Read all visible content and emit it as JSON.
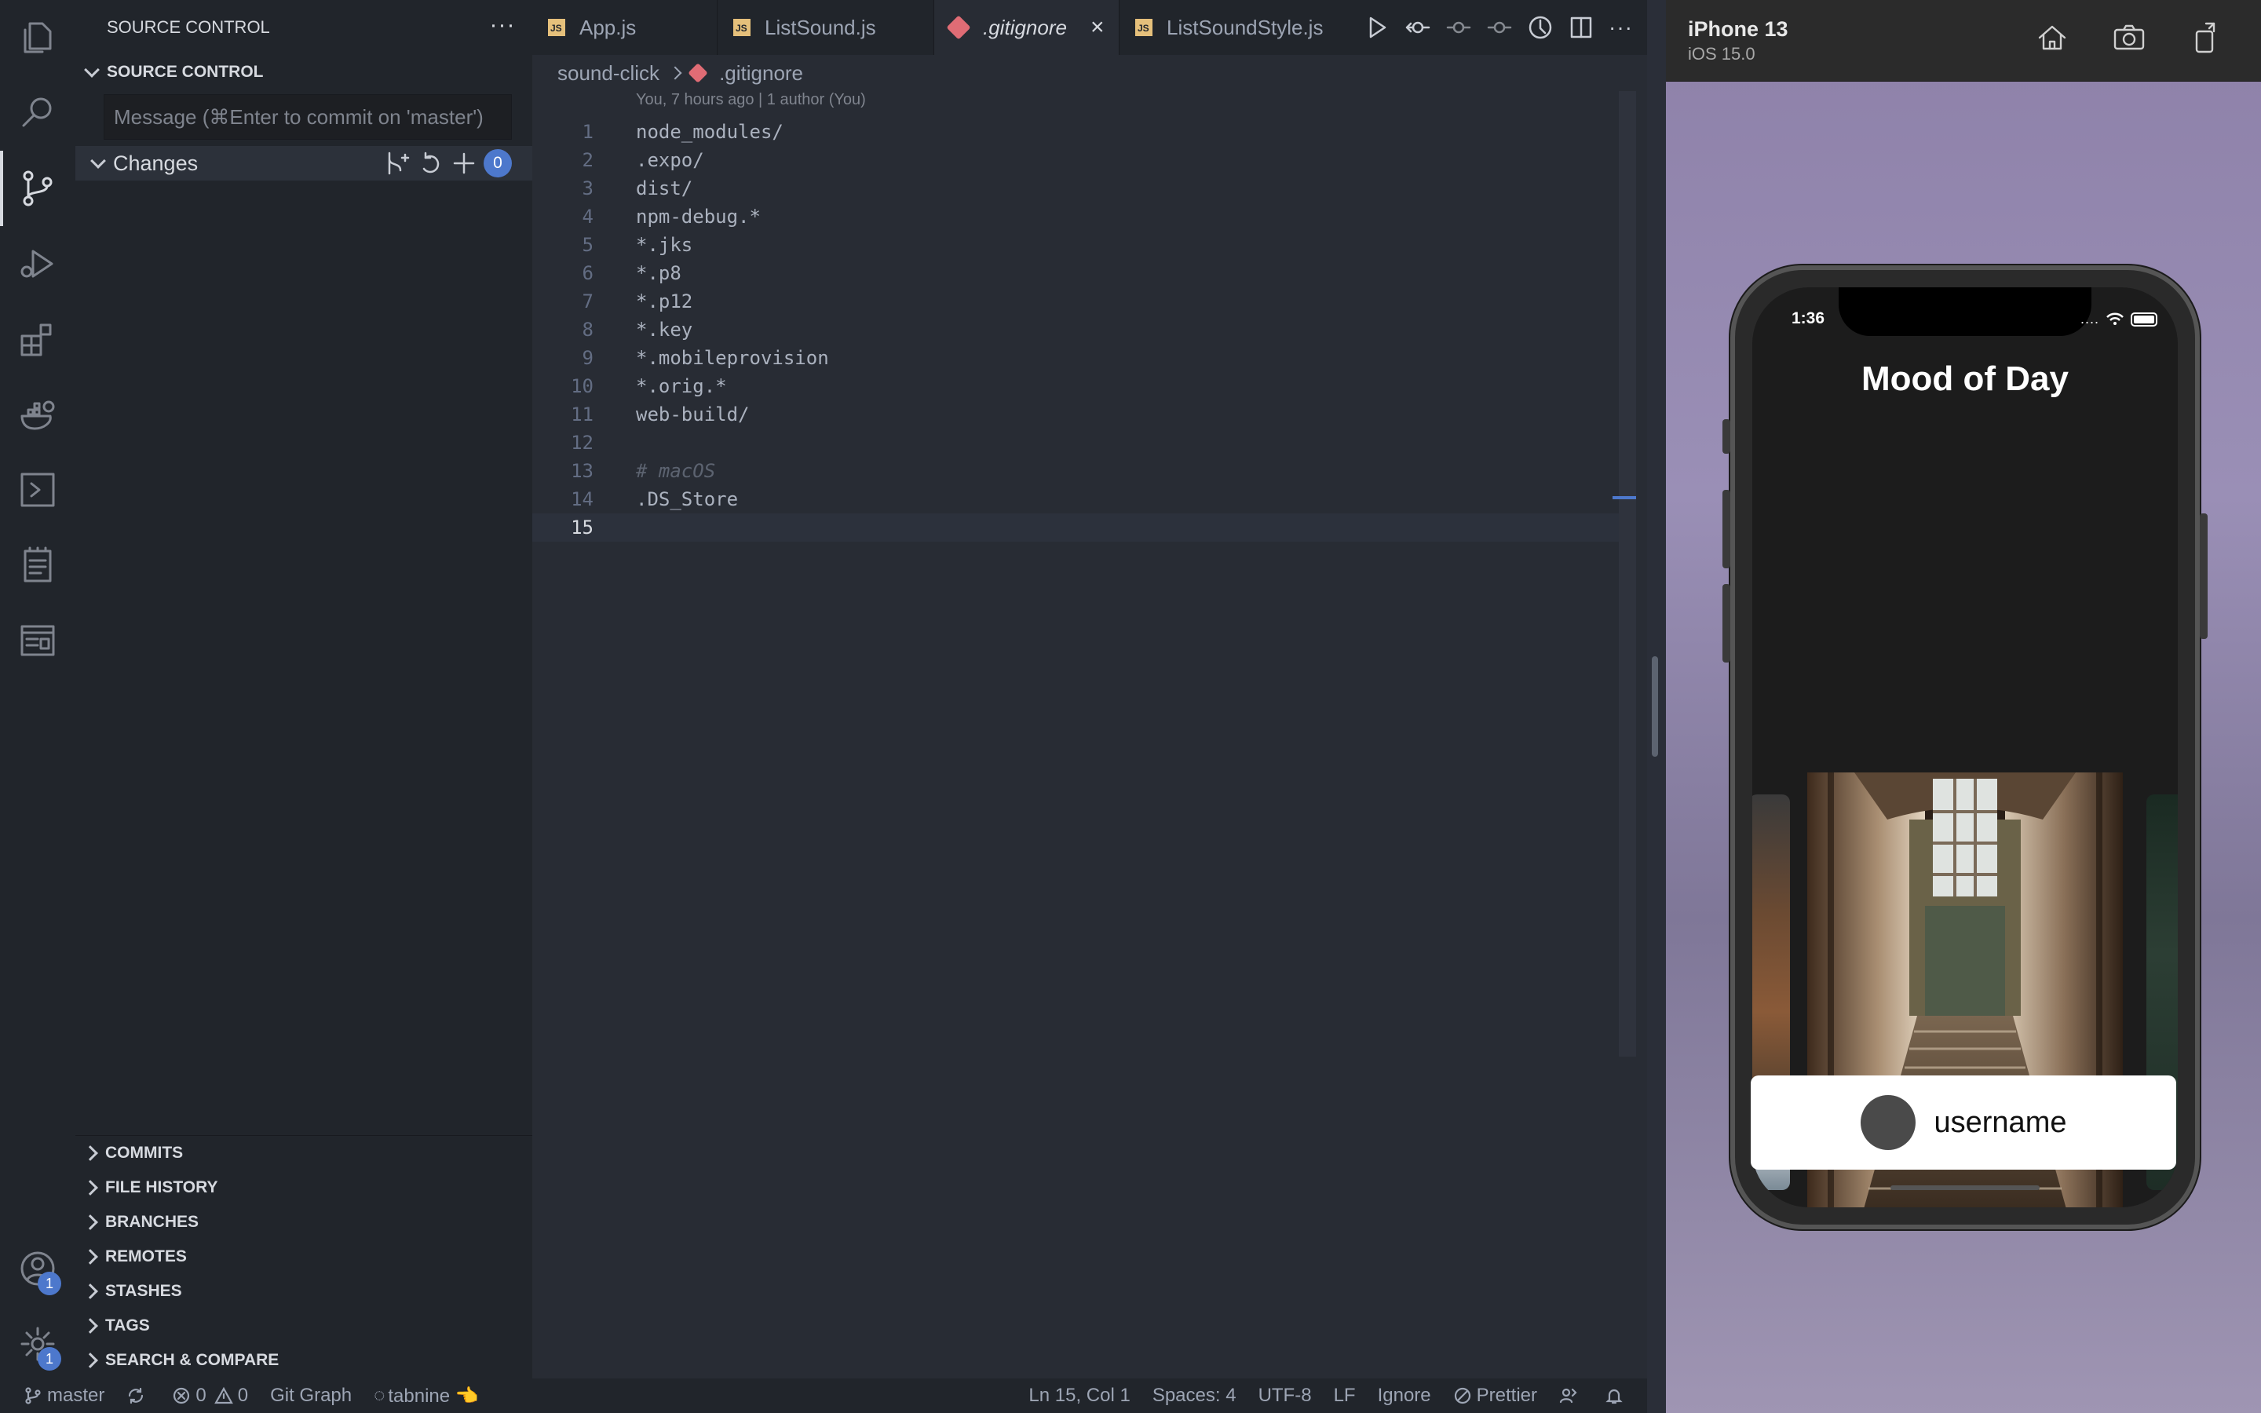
{
  "sidebar": {
    "title": "SOURCE CONTROL",
    "section_title": "SOURCE CONTROL",
    "commit_placeholder": "Message (⌘Enter to commit on 'master')",
    "changes_label": "Changes",
    "changes_count": "0",
    "panels": [
      "COMMITS",
      "FILE HISTORY",
      "BRANCHES",
      "REMOTES",
      "STASHES",
      "TAGS",
      "SEARCH & COMPARE"
    ]
  },
  "activity_bar": {
    "items": [
      "explorer-icon",
      "search-icon",
      "source-control-icon",
      "run-debug-icon",
      "extensions-icon",
      "docker-icon",
      "remote-icon",
      "notes-icon",
      "browser-preview-icon"
    ],
    "accounts_badge": "1",
    "settings_badge": "1"
  },
  "tabs": [
    {
      "label": "App.js",
      "type": "js"
    },
    {
      "label": "ListSound.js",
      "type": "js"
    },
    {
      "label": ".gitignore",
      "type": "git",
      "active": true
    },
    {
      "label": "ListSoundStyle.js",
      "type": "js"
    }
  ],
  "breadcrumb": {
    "folder": "sound-click",
    "file": ".gitignore"
  },
  "editor": {
    "blame": "You, 7 hours ago | 1 author (You)",
    "lines": [
      {
        "n": "1",
        "text": "node_modules/"
      },
      {
        "n": "2",
        "text": ".expo/"
      },
      {
        "n": "3",
        "text": "dist/"
      },
      {
        "n": "4",
        "text": "npm-debug.*"
      },
      {
        "n": "5",
        "text": "*.jks"
      },
      {
        "n": "6",
        "text": "*.p8"
      },
      {
        "n": "7",
        "text": "*.p12"
      },
      {
        "n": "8",
        "text": "*.key"
      },
      {
        "n": "9",
        "text": "*.mobileprovision"
      },
      {
        "n": "10",
        "text": "*.orig.*"
      },
      {
        "n": "11",
        "text": "web-build/"
      },
      {
        "n": "12",
        "text": ""
      },
      {
        "n": "13",
        "text": "# macOS"
      },
      {
        "n": "14",
        "text": ".DS_Store"
      },
      {
        "n": "15",
        "text": ""
      }
    ]
  },
  "statusbar": {
    "branch": "master",
    "errors": "0",
    "warnings": "0",
    "git_graph": "Git Graph",
    "tabnine": "tabnine 👈",
    "position": "Ln 15, Col 1",
    "spaces": "Spaces: 4",
    "encoding": "UTF-8",
    "eol": "LF",
    "language": "Ignore",
    "prettier": "Prettier"
  },
  "simulator": {
    "device": "iPhone 13",
    "os": "iOS 15.0",
    "time": "1:36",
    "app_title": "Mood of Day",
    "username": "username"
  },
  "colors": {
    "accent": "#4d78cc",
    "editor_bg": "#282c34",
    "sidebar_bg": "#21252b",
    "git_icon": "#e06c75",
    "js_icon": "#e5c07b"
  }
}
